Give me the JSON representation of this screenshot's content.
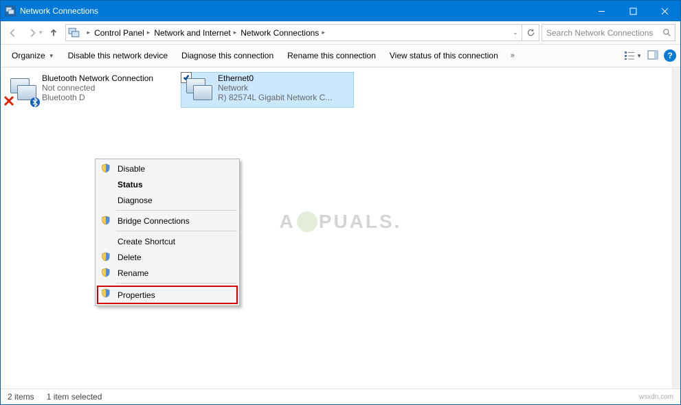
{
  "window": {
    "title": "Network Connections"
  },
  "breadcrumbs": {
    "a": "Control Panel",
    "b": "Network and Internet",
    "c": "Network Connections"
  },
  "search": {
    "placeholder": "Search Network Connections"
  },
  "commands": {
    "organize": "Organize",
    "disable": "Disable this network device",
    "diagnose": "Diagnose this connection",
    "rename": "Rename this connection",
    "viewstatus": "View status of this connection"
  },
  "items": {
    "bt": {
      "name": "Bluetooth Network Connection",
      "status": "Not connected",
      "device": "Bluetooth D"
    },
    "eth": {
      "name": "Ethernet0",
      "status": "Network",
      "device": "R) 82574L Gigabit Network C..."
    }
  },
  "context_menu": {
    "disable": "Disable",
    "status": "Status",
    "diagnose": "Diagnose",
    "bridge": "Bridge Connections",
    "shortcut": "Create Shortcut",
    "delete": "Delete",
    "rename": "Rename",
    "properties": "Properties"
  },
  "statusbar": {
    "count": "2 items",
    "selected": "1 item selected",
    "domain": "wsxdn.com"
  },
  "watermark": {
    "text_a": "A",
    "text_b": "PUALS."
  }
}
